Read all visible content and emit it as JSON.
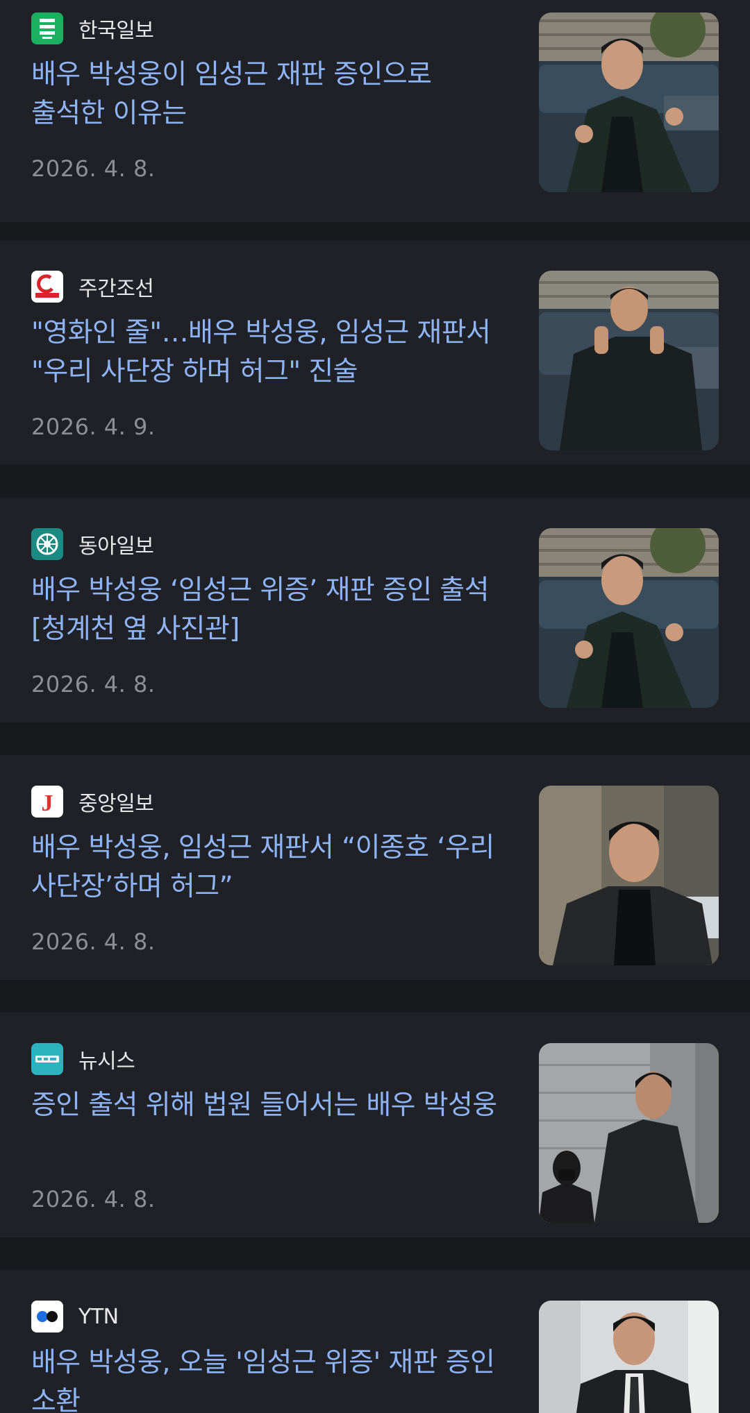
{
  "articles": [
    {
      "press": "한국일보",
      "press_logo_icon": "hankook-ilbo-logo-icon",
      "press_logo_color": "#1bb05f",
      "headline": "배우 박성웅이 임성근 재판 증인으로 출석한 이유는",
      "date": "2026. 4. 8.",
      "thumb_icon": "photo-man-courthouse-cars",
      "thumb_bg": "#2b3a45"
    },
    {
      "press": "주간조선",
      "press_logo_icon": "weekly-chosun-logo-icon",
      "press_logo_color": "#ffffff",
      "headline": "\"영화인 줄\"…배우 박성웅, 임성근 재판서 \"우리 사단장 하며 허그\" 진술",
      "date": "2026. 4. 9.",
      "thumb_icon": "photo-man-jacket-cars",
      "thumb_bg": "#2e3a44"
    },
    {
      "press": "동아일보",
      "press_logo_icon": "donga-ilbo-logo-icon",
      "press_logo_color": "#1a8a82",
      "headline": "배우 박성웅 ‘임성근 위증’ 재판 증인 출석[청계천 옆 사진관]",
      "date": "2026. 4. 8.",
      "thumb_icon": "photo-man-courthouse-cars",
      "thumb_bg": "#2b3a45"
    },
    {
      "press": "중앙일보",
      "press_logo_icon": "joongang-ilbo-logo-icon",
      "press_logo_color": "#ffffff",
      "headline": "배우 박성웅, 임성근 재판서 “이종호 ‘우리 사단장’하며 허그”",
      "date": "2026. 4. 8.",
      "thumb_icon": "photo-man-dark-suit",
      "thumb_bg": "#6f6a5e"
    },
    {
      "press": "뉴시스",
      "press_logo_icon": "newsis-logo-icon",
      "press_logo_color": "#2bb3c0",
      "headline": "증인 출석 위해 법원 들어서는 배우 박성웅",
      "date": "2026. 4. 8.",
      "thumb_icon": "photo-man-entering-court",
      "thumb_bg": "#8d8f92"
    },
    {
      "press": "YTN",
      "press_logo_icon": "ytn-logo-icon",
      "press_logo_color": "#ffffff",
      "headline": "배우 박성웅, 오늘 '임성근 위증' 재판 증인 소환",
      "date": "",
      "thumb_icon": "photo-man-suit-tie",
      "thumb_bg": "#d9dadc"
    }
  ]
}
